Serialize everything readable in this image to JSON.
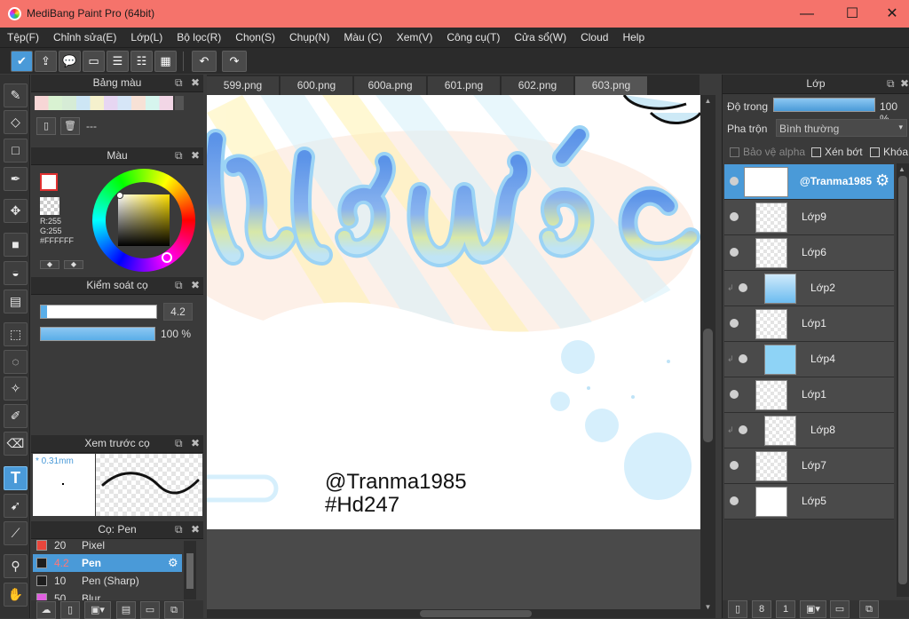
{
  "window": {
    "title": "MediBang Paint Pro (64bit)",
    "controls": {
      "minimize": "—",
      "maximize": "☐",
      "close": "✕"
    }
  },
  "menu": [
    "Tệp(F)",
    "Chỉnh sửa(E)",
    "Lớp(L)",
    "Bộ lọc(R)",
    "Chọn(S)",
    "Chụp(N)",
    "Màu (C)",
    "Xem(V)",
    "Công cụ(T)",
    "Cửa sổ(W)",
    "Cloud",
    "Help"
  ],
  "toolbar": {
    "icons": [
      "cloud-save-icon",
      "share-icon",
      "comment-icon",
      "speech-icon",
      "document-icon",
      "checklist-icon",
      "grid-check-icon",
      "undo-icon",
      "redo-icon"
    ]
  },
  "tools": [
    "brush-icon",
    "eraser-icon",
    "rectangle-icon",
    "pen-icon",
    "move-icon",
    "fill-rect-icon",
    "bucket-icon",
    "gradient-icon",
    "select-rect-icon",
    "lasso-icon",
    "magic-wand-icon",
    "select-pen-icon",
    "select-eraser-icon",
    "text-icon",
    "operation-icon",
    "divide-icon",
    "eyedropper-icon",
    "hand-icon"
  ],
  "palette_panel": {
    "title": "Bảng màu",
    "name": "---"
  },
  "color_panel": {
    "title": "Màu",
    "r": "R:255",
    "g": "G:255",
    "hex": "#FFFFFF",
    "foreground": "#ffffff",
    "background": "#ffffff"
  },
  "brush_control": {
    "title": "Kiểm soát cọ",
    "size": "4.2",
    "opacity": "100 %",
    "opacity_value": 100
  },
  "brush_preview": {
    "title": "Xem trước cọ",
    "size_label": "* 0.31mm"
  },
  "brushes": {
    "title": "Cọ: Pen",
    "items": [
      {
        "size": "20",
        "name": "Pixel",
        "color": "#e8463c"
      },
      {
        "size": "4.2",
        "name": "Pen",
        "color": "#1e1e1e",
        "selected": true
      },
      {
        "size": "10",
        "name": "Pen (Sharp)",
        "color": "#1e1e1e"
      },
      {
        "size": "50",
        "name": "Blur",
        "color": "#e060e0"
      }
    ]
  },
  "tabs": [
    "599.png",
    "600.png",
    "600a.png",
    "601.png",
    "602.png",
    "603.png"
  ],
  "active_tab": 5,
  "canvas": {
    "watermark_line1": "@Tranma1985",
    "watermark_line2": "#Hd247"
  },
  "layers_panel": {
    "title": "Lớp",
    "opacity_label": "Độ trong",
    "opacity_value": "100 %",
    "blend_label": "Pha trộn",
    "blend_value": "Bình thường",
    "protect_alpha": "Bảo vệ alpha",
    "clip": "Xén bớt",
    "lock": "Khóa",
    "layers": [
      {
        "name": "@Tranma1985",
        "selected": true,
        "clipped": false
      },
      {
        "name": "Lớp9",
        "clipped": false
      },
      {
        "name": "Lớp6",
        "clipped": false
      },
      {
        "name": "Lớp2",
        "clipped": true
      },
      {
        "name": "Lớp1",
        "clipped": false
      },
      {
        "name": "Lớp4",
        "clipped": true
      },
      {
        "name": "Lớp1",
        "clipped": false
      },
      {
        "name": "Lớp8",
        "clipped": true
      },
      {
        "name": "Lớp7",
        "clipped": false
      },
      {
        "name": "Lớp5",
        "clipped": false
      }
    ]
  }
}
